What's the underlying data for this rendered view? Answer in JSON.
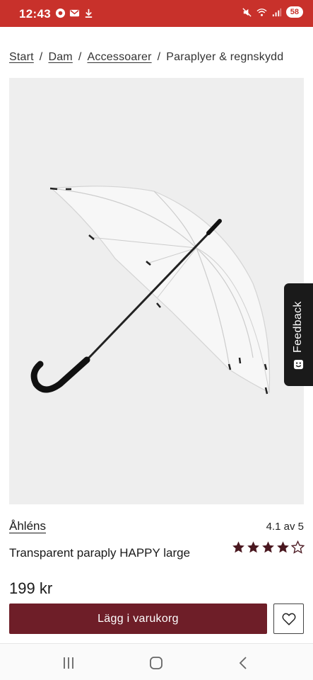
{
  "status_bar": {
    "time": "12:43",
    "battery": "58",
    "bg_color": "#c8312b"
  },
  "breadcrumb": {
    "items": [
      "Start",
      "Dam",
      "Accessoarer"
    ],
    "current": "Paraplyer & regnskydd",
    "separator": "/"
  },
  "product": {
    "brand": "Åhléns",
    "rating_text": "4.1 av 5",
    "rating": 4.1,
    "rating_max": 5,
    "stars_filled": 4,
    "name": "Transparent paraply HAPPY large",
    "price": "199 kr",
    "image_icon": "umbrella-image"
  },
  "actions": {
    "add_to_cart": "Lägg i varukorg",
    "add_to_cart_color": "#6e1e28",
    "wishlist_icon": "heart-icon"
  },
  "feedback": {
    "label": "Feedback",
    "icon": "smiley-icon"
  },
  "nav": {
    "recent_icon": "recent-apps-icon",
    "home_icon": "home-icon",
    "back_icon": "back-icon"
  }
}
